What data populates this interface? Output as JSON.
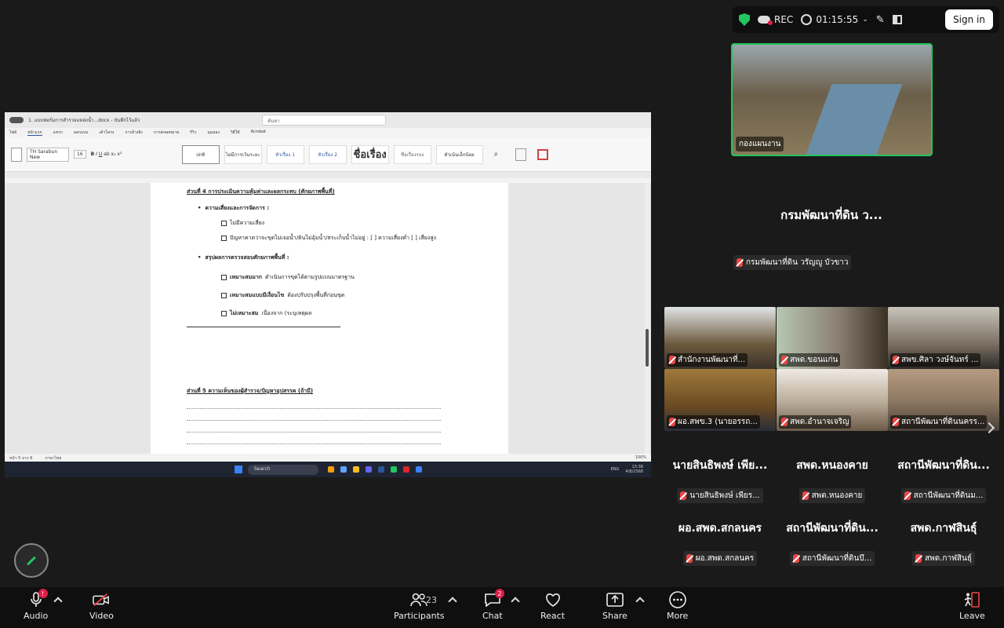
{
  "topbar": {
    "rec_label": "REC",
    "timer": "01:15:55",
    "signin_label": "Sign in"
  },
  "word": {
    "title": "1. แบบฟอร์มการสำรวจแหล่งน้ำ...docx - บันทึกไว้แล้ว",
    "search_placeholder": "ค้นหา",
    "tabs": [
      "ไฟล์",
      "หน้าแรก",
      "แทรก",
      "ออกแบบ",
      "เค้าโครง",
      "การอ้างอิง",
      "การส่งจดหมาย",
      "รีวิว",
      "มุมมอง",
      "วิธีใช้",
      "Acrobat"
    ],
    "font_name": "TH Sarabun New",
    "font_size": "16",
    "styles": [
      "ปกติ",
      "ไม่มีการเว้นระยะ",
      "หัวเรื่อง 1",
      "หัวเรื่อง 2",
      "ชื่อเรื่อง",
      "ชื่อเรื่องรอง",
      "ตัวเน้นเล็กน้อย"
    ],
    "status_left": "หน้า 5 จาก 6",
    "status_words": "ภาษาไทย",
    "status_zoom": "100%"
  },
  "doc": {
    "section4_heading": "ส่วนที่ 4 การประเมินความคุ้มค่าและผลกระทบ (ศักยภาพพื้นที่)",
    "risk_heading": "ความเสี่ยงและการจัดการ :",
    "risk_opt1": "ไม่มีความเสี่ยง",
    "risk_opt2": "ปัญหาคาดว่าจะขุดไม่เจอน้ำ/ดินไม่อุ้มน้ำ/สระเก็บน้ำไม่อยู่ : [ ] ความเสี่ยงต่ำ [ ] เสี่ยงสูง",
    "summary_heading": "สรุปผลการตรวจสอบศักยภาพพื้นที่ :",
    "sum_opt1_bold": "เหมาะสมมาก",
    "sum_opt1_text": "ดำเนินการขุดได้ตามรูปแบบมาตรฐาน",
    "sum_opt2_bold": "เหมาะสมแบบมีเงื่อนไข",
    "sum_opt2_text": "ต้องปรับปรุงพื้นที่ก่อนขุด",
    "sum_opt3_bold": "ไม่เหมาะสม",
    "sum_opt3_text": "เนื่องจาก (ระบุเหตุผล",
    "section5_heading": "ส่วนที่ 5 ความเห็นของผู้สำรวจ/ปัญหาอุปสรรค (ถ้ามี)"
  },
  "taskbar": {
    "search_label": "Search",
    "lang": "ENG",
    "time": "13:38",
    "date": "4/8/2568"
  },
  "pinned": {
    "label": "กองแผนงาน"
  },
  "spotlight": {
    "name": "กรมพัฒนาที่ดิน ว...",
    "sub": "กรมพัฒนาที่ดิน วรัญญู บัวขาว"
  },
  "grid": [
    "สำนักงานพัฒนาที่...",
    "สพด.ขอนแก่น",
    "สพข.ศิลา วงษ์จันทร์ ...",
    "ผอ.สพข.3 (นายอรรถ...",
    "สพด.อำนาจเจริญ",
    "สถานีพัฒนาที่ดินนครร..."
  ],
  "names": [
    {
      "big": "นายสินธิพงษ์ เพีย...",
      "small": "นายสินธิพงษ์ เพียร..."
    },
    {
      "big": "สพด.หนองคาย",
      "small": "สพด.หนองคาย"
    },
    {
      "big": "สถานีพัฒนาที่ดิน...",
      "small": "สถานีพัฒนาที่ดินม..."
    },
    {
      "big": "ผอ.สพด.สกลนคร",
      "small": "ผอ.สพด.สกลนคร"
    },
    {
      "big": "สถานีพัฒนาที่ดิน...",
      "small": "สถานีพัฒนาที่ดินบึ..."
    },
    {
      "big": "สพด.กาฬสินธุ์",
      "small": "สพด.กาฬสินธุ์"
    }
  ],
  "toolbar": {
    "audio": "Audio",
    "audio_badge": "!",
    "video": "Video",
    "participants": "Participants",
    "participants_count": "23",
    "chat": "Chat",
    "chat_badge": "2",
    "react": "React",
    "share": "Share",
    "more": "More",
    "leave": "Leave"
  },
  "colors": {
    "accent_green": "#22c55e",
    "alert_red": "#e11d48",
    "background": "#1a1a1a"
  }
}
